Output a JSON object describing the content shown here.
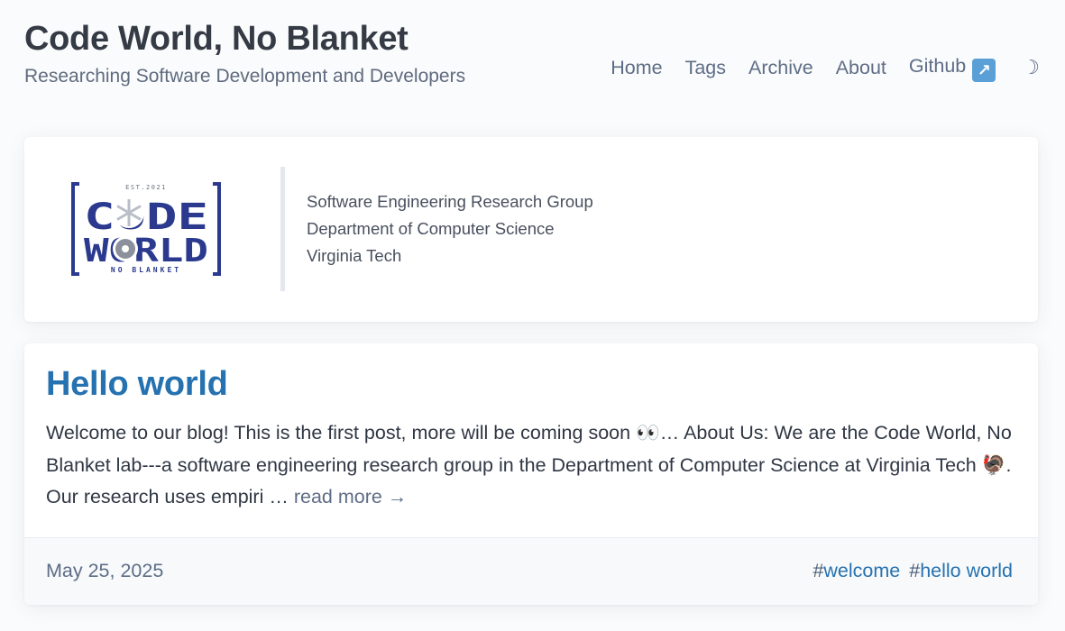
{
  "site": {
    "title": "Code World, No Blanket",
    "subtitle": "Researching Software Development and Developers"
  },
  "nav": {
    "items": [
      {
        "label": "Home"
      },
      {
        "label": "Tags"
      },
      {
        "label": "Archive"
      },
      {
        "label": "About"
      },
      {
        "label": "Github",
        "icon": "external-link-arrow-icon"
      }
    ],
    "theme_toggle_icon": "moon-icon",
    "theme_toggle_glyph": "☽"
  },
  "profile": {
    "logo": {
      "est_text": "EST.2021",
      "line1": "CODE",
      "line2": "WORLD",
      "tagline": "NO BLANKET"
    },
    "affiliation": [
      "Software Engineering Research Group",
      "Department of Computer Science",
      "Virginia Tech"
    ]
  },
  "posts": [
    {
      "title": "Hello world",
      "excerpt": "Welcome to our blog! This is the first post, more will be coming soon 👀… About Us: We are the Code World, No Blanket lab---a software engineering research group in the Department of Computer Science at Virginia Tech 🦃. Our research uses empiri …",
      "read_more": "read more →",
      "date": "May 25, 2025",
      "tags": [
        {
          "hash": "#",
          "label": "welcome"
        },
        {
          "hash": "#",
          "label": "hello world"
        }
      ]
    }
  ],
  "colors": {
    "accent": "#2672b0",
    "logo_navy": "#2b3a8f",
    "muted": "#5e6d86"
  }
}
